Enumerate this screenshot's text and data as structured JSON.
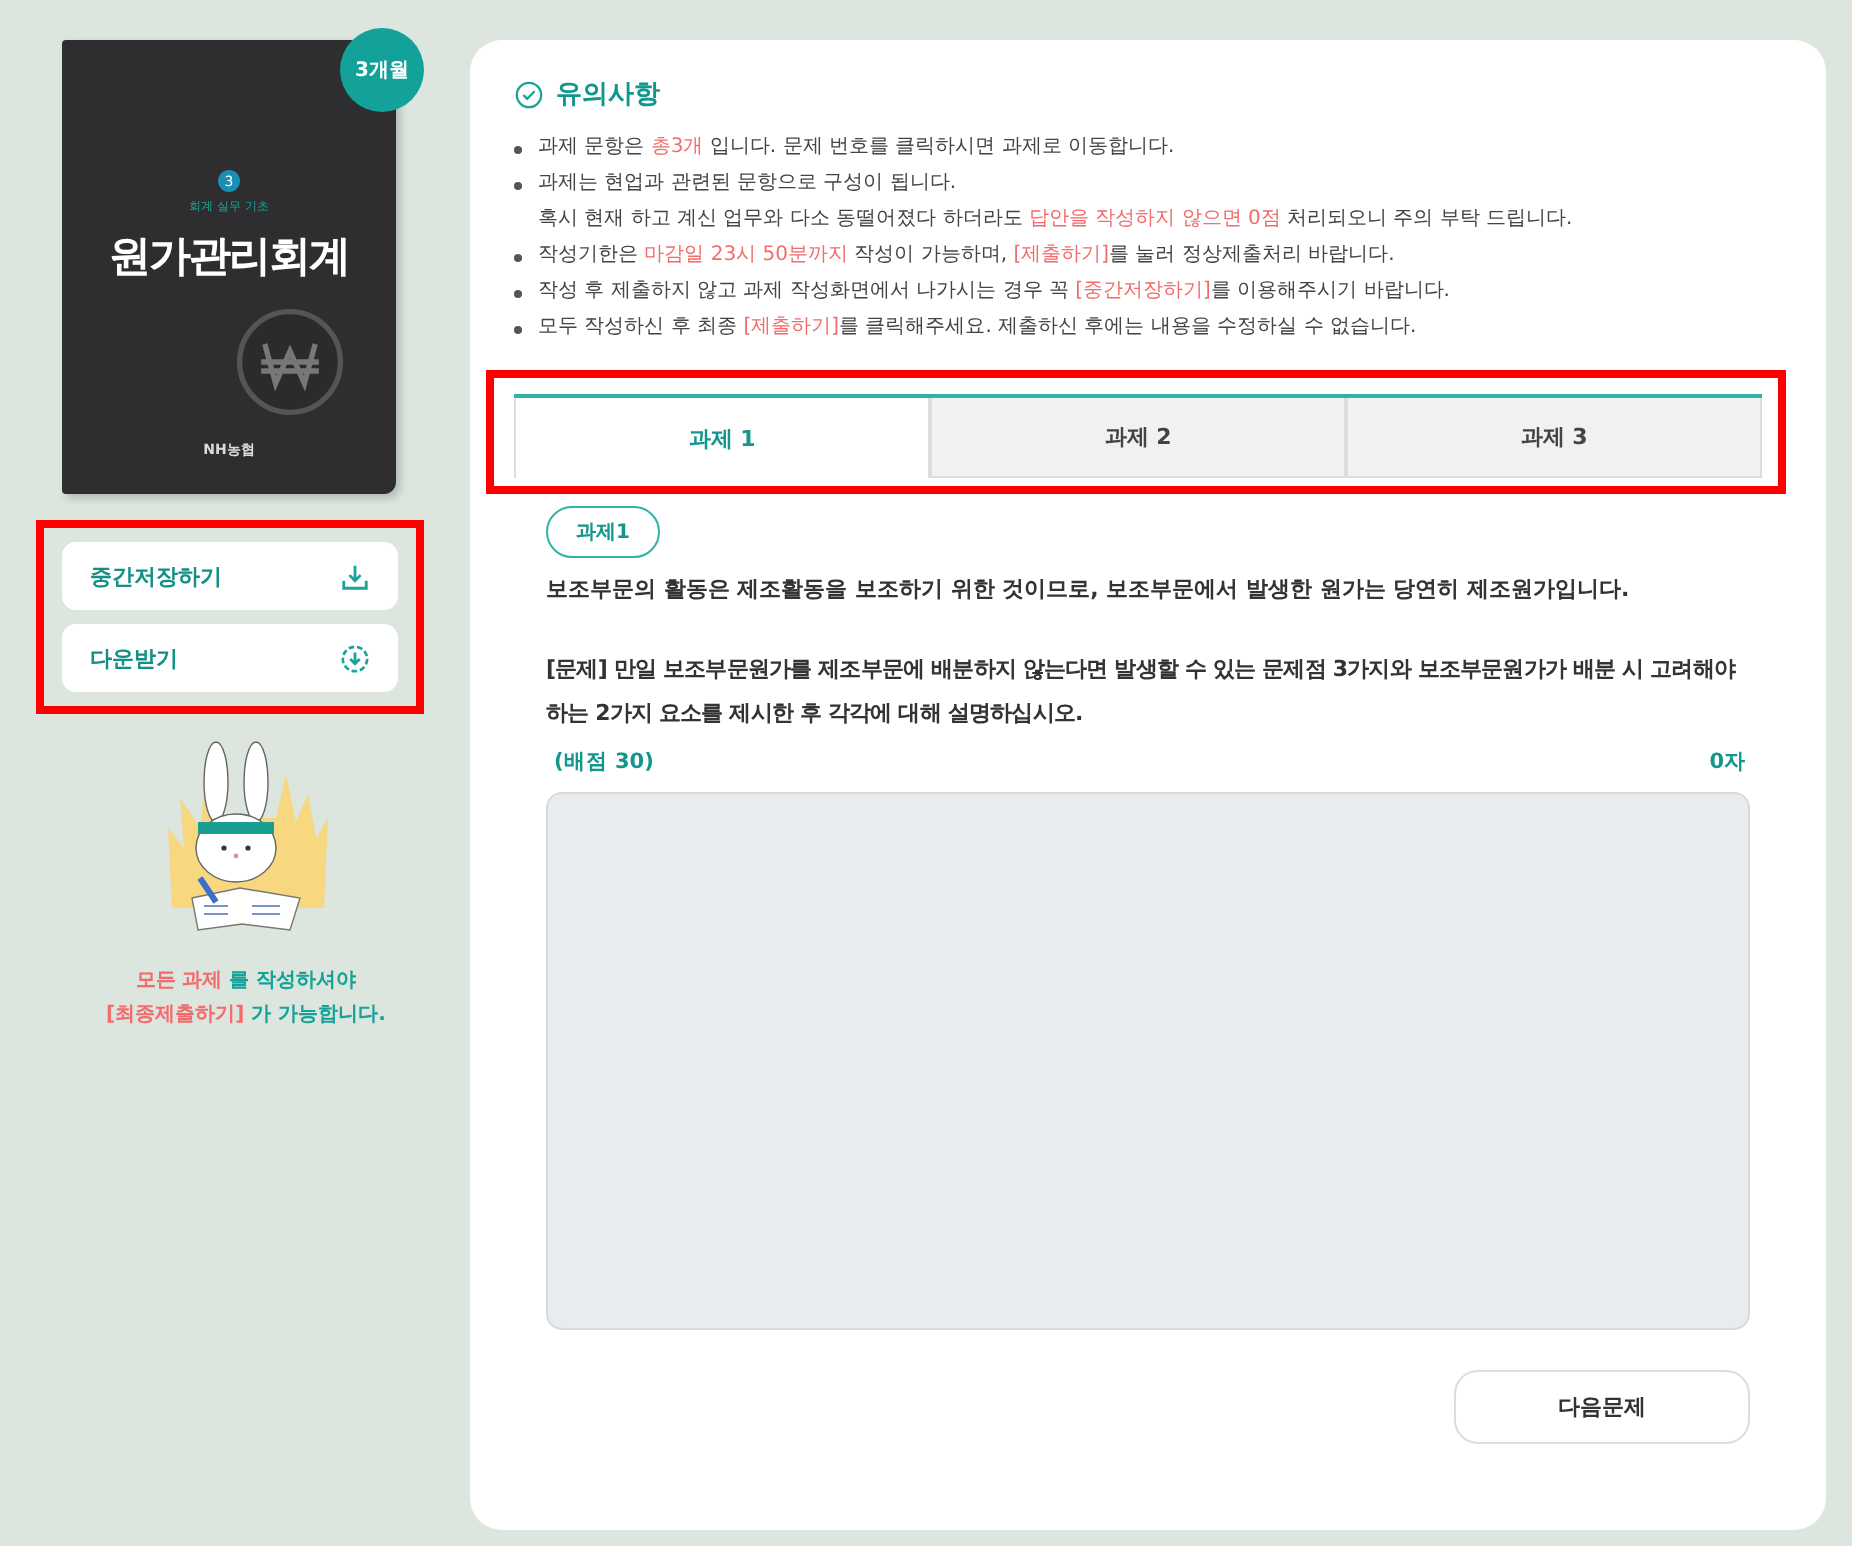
{
  "book": {
    "badge": "3개월",
    "number": "3",
    "series": "회계 실무 기초",
    "title": "원가관리회계",
    "publisher": "NH농협"
  },
  "side_buttons": [
    {
      "label": "중간저장하기",
      "kind": "save"
    },
    {
      "label": "다운받기",
      "kind": "download"
    }
  ],
  "side_message": [
    [
      {
        "text": "모든 과제",
        "highlight": true
      },
      {
        "text": " 를 작성하셔야",
        "highlight": false
      }
    ],
    [
      {
        "text": "[최종제출하기]",
        "highlight": true
      },
      {
        "text": " 가 가능합니다.",
        "highlight": false
      }
    ]
  ],
  "notice": {
    "title": "유의사항",
    "items": [
      [
        [
          {
            "text": "과제 문항은 ",
            "highlight": false
          },
          {
            "text": "총3개",
            "highlight": true
          },
          {
            "text": " 입니다. 문제 번호를 클릭하시면 과제로 이동합니다.",
            "highlight": false
          }
        ]
      ],
      [
        [
          {
            "text": "과제는 현업과 관련된 문항으로 구성이 됩니다.",
            "highlight": false
          }
        ],
        [
          {
            "text": "혹시 현재 하고 계신 업무와 다소 동떨어졌다 하더라도 ",
            "highlight": false
          },
          {
            "text": "답안을 작성하지 않으면 0점",
            "highlight": true
          },
          {
            "text": " 처리되오니 주의 부탁 드립니다.",
            "highlight": false
          }
        ]
      ],
      [
        [
          {
            "text": "작성기한은 ",
            "highlight": false
          },
          {
            "text": "마감일 23시 50분까지",
            "highlight": true
          },
          {
            "text": " 작성이 가능하며, ",
            "highlight": false
          },
          {
            "text": "[제출하기]",
            "highlight": true
          },
          {
            "text": "를 눌러 정상제출처리 바랍니다.",
            "highlight": false
          }
        ]
      ],
      [
        [
          {
            "text": "작성 후 제출하지 않고 과제 작성화면에서 나가시는 경우 꼭 ",
            "highlight": false
          },
          {
            "text": "[중간저장하기]",
            "highlight": true
          },
          {
            "text": "를 이용해주시기 바랍니다.",
            "highlight": false
          }
        ]
      ],
      [
        [
          {
            "text": "모두 작성하신 후 최종 ",
            "highlight": false
          },
          {
            "text": "[제출하기]",
            "highlight": true
          },
          {
            "text": "를 클릭해주세요. 제출하신 후에는 내용을 수정하실 수 없습니다.",
            "highlight": false
          }
        ]
      ]
    ]
  },
  "tabs": [
    {
      "label": "과제 1",
      "selected": true
    },
    {
      "label": "과제 2",
      "selected": false
    },
    {
      "label": "과제 3",
      "selected": false
    }
  ],
  "task": {
    "tag": "과제1",
    "intro": "보조부문의 활동은 제조활동을 보조하기 위한 것이므로, 보조부문에서 발생한 원가는 당연히 제조원가입니다.",
    "question": "[문제] 만일 보조부문원가를 제조부문에 배분하지 않는다면 발생할 수 있는 문제점 3가지와 보조부문원가가 배분 시 고려해야 하는 2가지 요소를 제시한 후 각각에 대해 설명하십시오.",
    "score": "(배점 30)",
    "char_count": "0자"
  },
  "next_button": "다음문제"
}
